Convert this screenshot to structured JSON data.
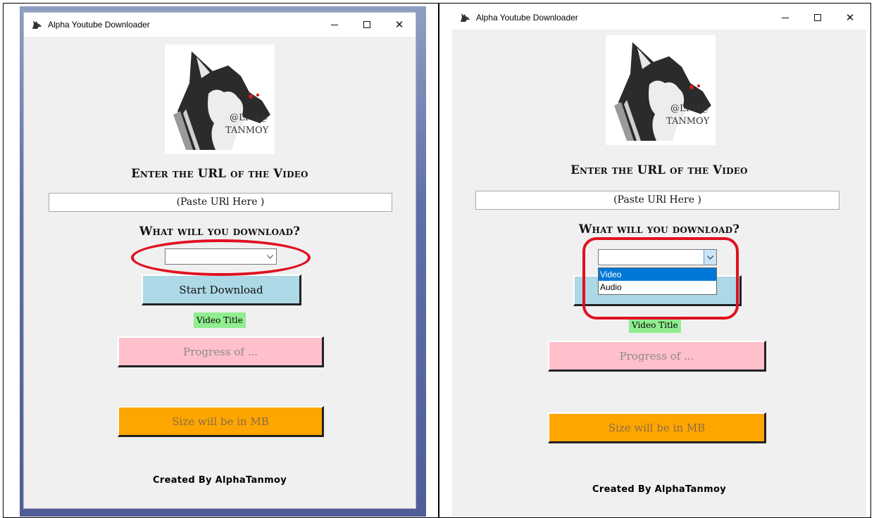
{
  "window_title": "Alpha Youtube Downloader",
  "logo_text_line1": "@LPH@",
  "logo_text_line2": "TANMOY",
  "url_heading": "Enter the URL of the Video",
  "url_entry_text": "(Paste URl Here )",
  "download_heading": "What will you download?",
  "combo_selected": "",
  "combo_options": [
    "Video",
    "Audio"
  ],
  "start_button_label": "Start Download",
  "video_title_label": "Video Title",
  "progress_label": "Progress of ...",
  "size_label": "Size will be in MB",
  "credits": "Created By AlphaTanmoy",
  "window_controls": {
    "minimize": "minimize-icon",
    "maximize": "maximize-icon",
    "close": "close-icon"
  },
  "colors": {
    "start_button": "#add8e6",
    "progress_button": "#ffc0cb",
    "size_button": "#ffa500",
    "title_label": "#90ee90",
    "annotation": "#e01020",
    "selection": "#0078d7"
  }
}
